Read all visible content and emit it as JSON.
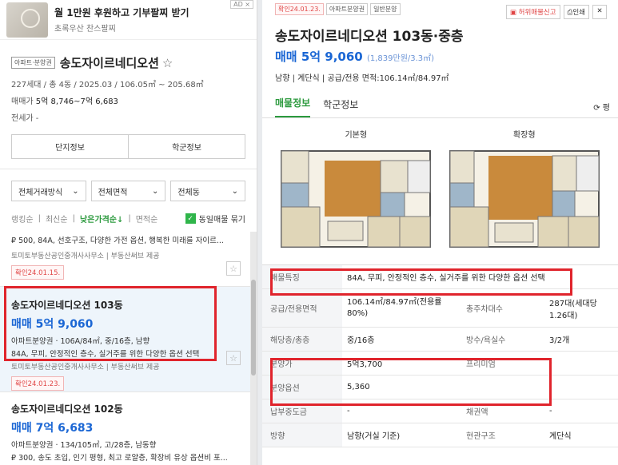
{
  "ad": {
    "title": "월 1만원 후원하고 기부팔찌 받기",
    "subtitle": "초록우산 찬스팔찌",
    "tag": "AD ×"
  },
  "complex": {
    "tag": "아파트·분양권",
    "name": "송도자이르네디오션",
    "star": "☆",
    "meta": "227세대 / 총 4동 / 2025.03 / 106.05㎡ ~ 205.68㎡",
    "sale_label": "매매가",
    "sale_value": "5억 8,746~7억 6,683",
    "rent_label": "전세가 -",
    "btn_info": "단지정보",
    "btn_school": "학군정보"
  },
  "filters": [
    {
      "label": "전체거래방식"
    },
    {
      "label": "전체면적"
    },
    {
      "label": "전체동"
    }
  ],
  "sort": {
    "items": [
      "랭킹순",
      "최신순"
    ],
    "active": "낮은가격순↓",
    "area": "면적순",
    "same_check": "동일매물 묶기",
    "sep": "|"
  },
  "listing0": {
    "desc": "₽ 500, 84A, 선호구조, 다양한 가전 옵션, 행복한 미래를 자이르...",
    "agent": "토미토부동산공인중개사사무소 | 부동산써브 제공",
    "badge": "확인24.01.15."
  },
  "listing1": {
    "title": "송도자이르네디오션 103동",
    "price": "매매 5억 9,060",
    "info": "아파트분양권 · 106A/84㎡, 중/16층, 남향",
    "desc": "84A, 무피, 안정적인 층수, 실거주를 위한 다양한 옵션 선택",
    "agent": "토미토부동산공인중개사사무소 | 부동산써브 제공",
    "badge": "확인24.01.23."
  },
  "listing2": {
    "title": "송도자이르네디오션 102동",
    "price": "매매 7억 6,683",
    "info": "아파트분양권 · 134/105㎡, 고/28층, 남동향",
    "desc": "₽ 300, 송도 초입, 인기 평형, 최고 로얄층, 확장비 유상 옵션비 포..."
  },
  "detail": {
    "tags": [
      "확인24.01.23.",
      "아파트분양권",
      "일반분양"
    ],
    "actions": {
      "report": "허위매물신고",
      "print": "인쇄",
      "close": "✕"
    },
    "title": "송도자이르네디오션 103동·중층",
    "price": "매매 5억 9,060",
    "price_per": "(1,839만원/3.3㎡)",
    "sub": "남향 | 계단식 | 공급/전용 면적:106.14㎡/84.97㎡",
    "tabs": [
      "매물정보",
      "학군정보"
    ],
    "tab_right": "⟳ 평",
    "plan_labels": [
      "기본형",
      "확장형"
    ]
  },
  "table": {
    "feature_label": "매물특징",
    "feature_value": "84A, 무피, 안정적인 층수, 실거주를 위한 다양한 옵션 선택",
    "area_label": "공급/전용면적",
    "area_value": "106.14㎡/84.97㎡(전용률80%)",
    "parking_label": "총주차대수",
    "parking_value": "287대(세대당 1.26대)",
    "floor_label": "해당층/총층",
    "floor_value": "중/16층",
    "room_label": "방수/욕실수",
    "room_value": "3/2개",
    "presale_label": "분양가",
    "presale_value": "5억3,700",
    "premium_label": "프리미엄",
    "premium_value": "-",
    "option_label": "분양옵션",
    "option_value": "5,360",
    "deposit_label": "납부중도금",
    "deposit_value": "-",
    "debt_label": "채권액",
    "debt_value": "-",
    "dir_label": "방향",
    "dir_value": "남향(거실 기준)",
    "entry_label": "현관구조",
    "entry_value": "계단식"
  }
}
